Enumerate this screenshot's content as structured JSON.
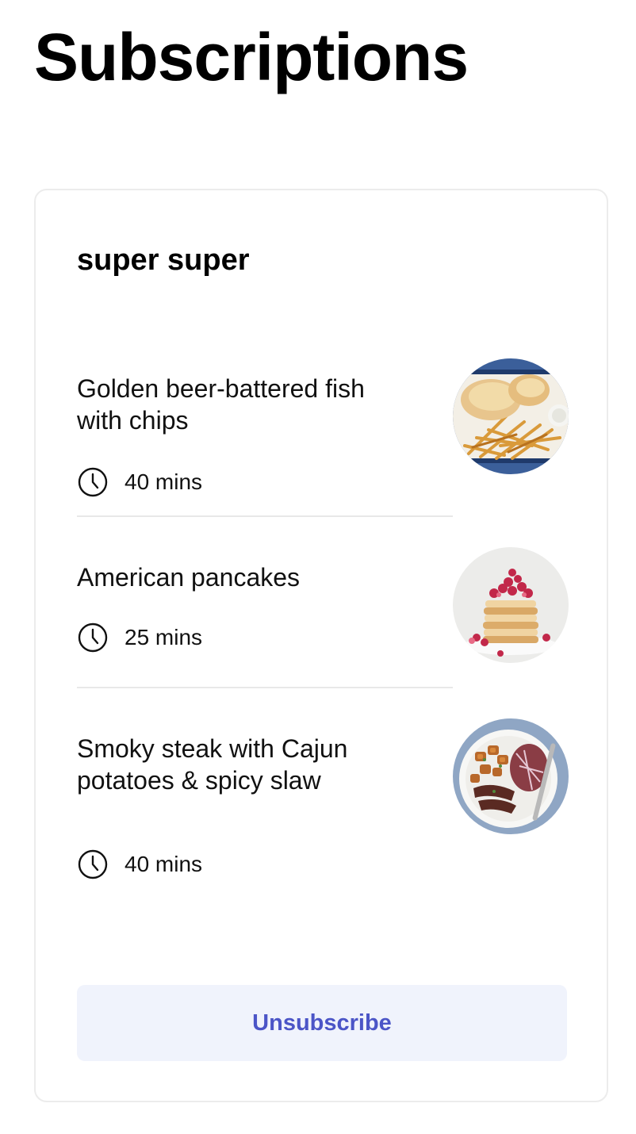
{
  "page": {
    "title": "Subscriptions"
  },
  "subscription": {
    "name": "super super",
    "recipes": [
      {
        "name": "Golden beer-battered fish with chips",
        "time": "40 mins",
        "image_icon": "fish-and-chips-photo"
      },
      {
        "name": "American pancakes",
        "time": "25 mins",
        "image_icon": "pancakes-photo"
      },
      {
        "name": "Smoky steak with Cajun potatoes & spicy slaw",
        "time": "40 mins",
        "image_icon": "steak-plate-photo"
      }
    ],
    "unsubscribe_label": "Unsubscribe"
  },
  "colors": {
    "accent": "#4b55c7",
    "button_bg": "#f0f3fc",
    "card_border": "#ececec",
    "divider": "#e8e8e8"
  }
}
